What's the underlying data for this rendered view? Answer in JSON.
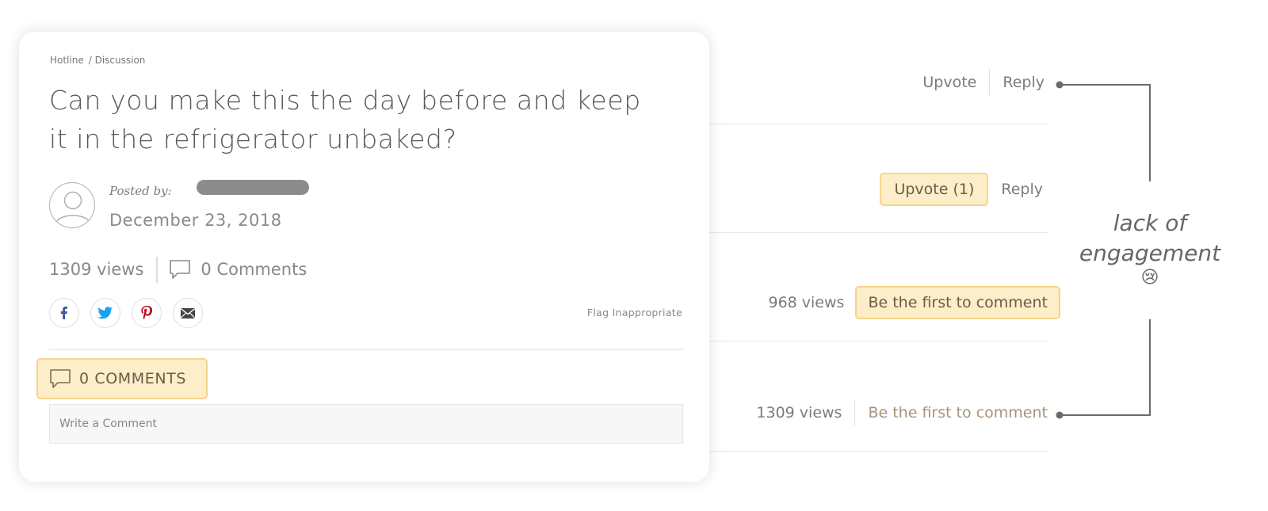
{
  "post": {
    "breadcrumb": [
      "Hotline",
      "/ Discussion"
    ],
    "title": "Can you make this the day before and keep it in the refrigerator unbaked?",
    "posted_by_label": "Posted by:",
    "date": "December 23, 2018",
    "views": "1309 views",
    "comments_count": "0 Comments",
    "flag": "Flag Inappropriate",
    "comments_header": "0 COMMENTS",
    "write_placeholder": "Write a Comment"
  },
  "list": {
    "row1": {
      "upvote": "Upvote",
      "reply": "Reply"
    },
    "row2": {
      "upvote": "Upvote (1)",
      "reply": "Reply"
    },
    "row3": {
      "views": "968 views",
      "cta": "Be the first to comment"
    },
    "row4": {
      "views": "1309 views",
      "cta": "Be the first to comment"
    }
  },
  "annotation": {
    "line1": "lack of",
    "line2": "engagement",
    "emoji": "😢"
  },
  "colors": {
    "highlight_bg": "#fdedc8",
    "highlight_border": "#f6d48a",
    "facebook": "#3b5998",
    "twitter": "#1da1f2",
    "pinterest": "#bd081c"
  }
}
